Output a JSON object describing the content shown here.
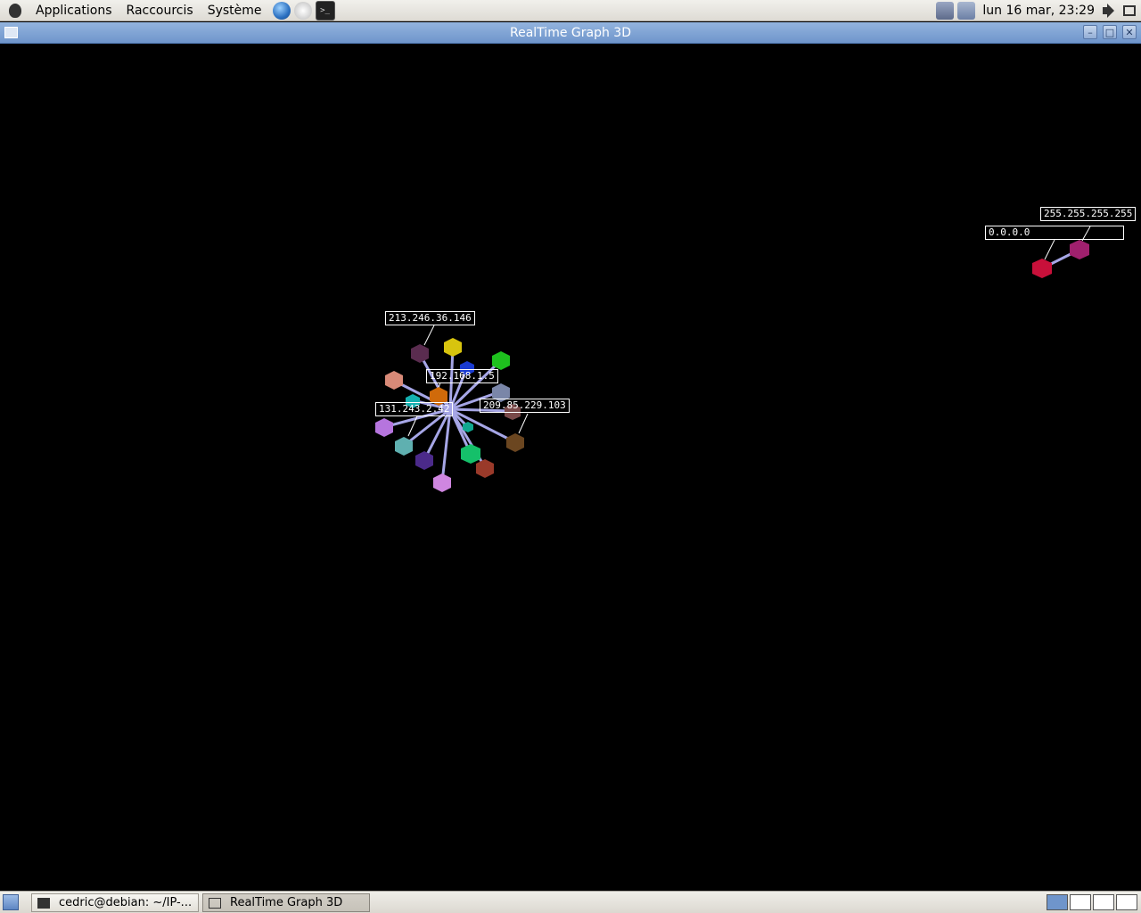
{
  "top_panel": {
    "menus": [
      "Applications",
      "Raccourcis",
      "Système"
    ],
    "launchers": [
      "web-browser-icon",
      "mail-icon",
      "terminal-icon"
    ],
    "clock": "lun 16 mar, 23:29"
  },
  "window": {
    "title": "RealTime Graph 3D"
  },
  "graph": {
    "labels": [
      "213.246.36.146",
      "192.168.1.5",
      "131.243.2.42",
      "209.85.229.103",
      "0.0.0.0",
      "255.255.255.255"
    ]
  },
  "taskbar": {
    "tasks": [
      "cedric@debian: ~/IP-...",
      "RealTime Graph 3D"
    ]
  },
  "colors": {
    "edge": "#a7a7e8",
    "title_bar": "#7fa3d6",
    "background": "#000000"
  }
}
